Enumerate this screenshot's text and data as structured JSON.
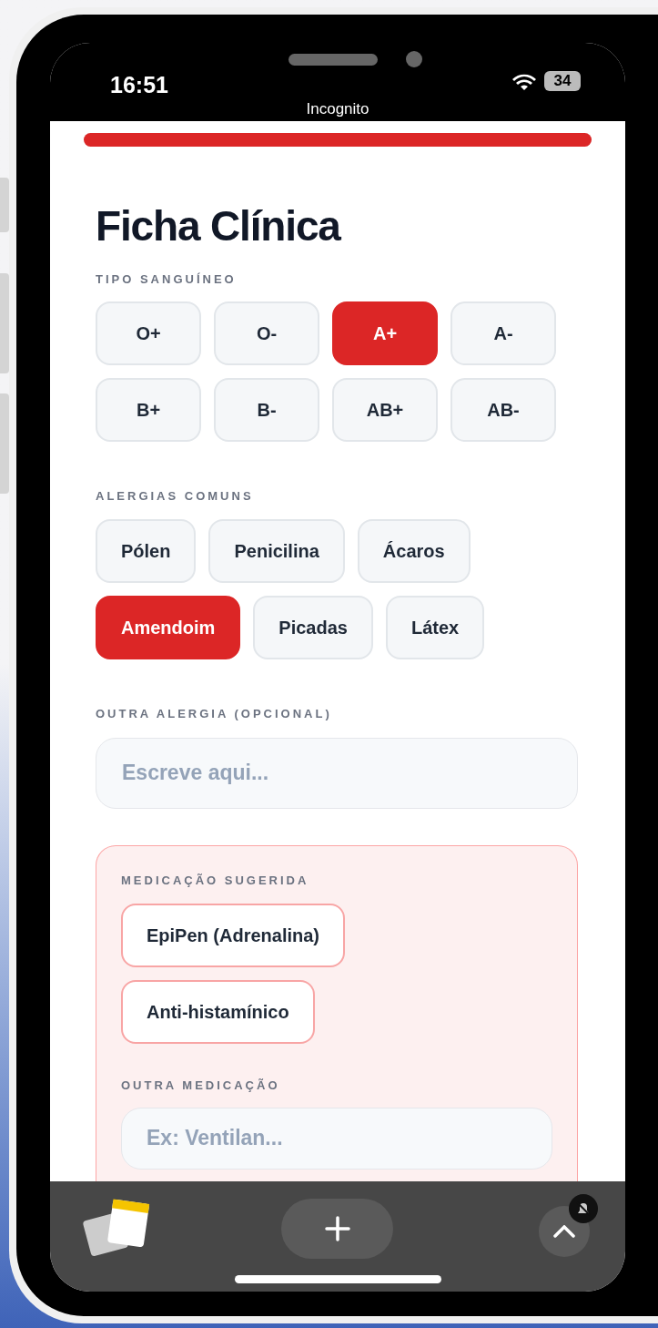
{
  "status_bar": {
    "time": "16:51",
    "battery": "34",
    "mode": "Incognito"
  },
  "progress": {
    "level": 1
  },
  "title": "Ficha Clínica",
  "blood_type": {
    "label": "TIPO SANGUÍNEO",
    "options": [
      {
        "label": "O+",
        "selected": false
      },
      {
        "label": "O-",
        "selected": false
      },
      {
        "label": "A+",
        "selected": true
      },
      {
        "label": "A-",
        "selected": false
      },
      {
        "label": "B+",
        "selected": false
      },
      {
        "label": "B-",
        "selected": false
      },
      {
        "label": "AB+",
        "selected": false
      },
      {
        "label": "AB-",
        "selected": false
      }
    ]
  },
  "allergies": {
    "label": "ALERGIAS COMUNS",
    "options": [
      {
        "label": "Pólen",
        "selected": false
      },
      {
        "label": "Penicilina",
        "selected": false
      },
      {
        "label": "Ácaros",
        "selected": false
      },
      {
        "label": "Amendoim",
        "selected": true
      },
      {
        "label": "Picadas",
        "selected": false
      },
      {
        "label": "Látex",
        "selected": false
      }
    ]
  },
  "other_allergy": {
    "label": "OUTRA ALERGIA (OPCIONAL)",
    "placeholder": "Escreve aqui..."
  },
  "medication": {
    "label": "MEDICAÇÃO SUGERIDA",
    "items": [
      "EpiPen (Adrenalina)",
      "Anti-histamínico"
    ],
    "other_label": "OUTRA MEDICAÇÃO",
    "other_placeholder": "Ex: Ventilan..."
  }
}
